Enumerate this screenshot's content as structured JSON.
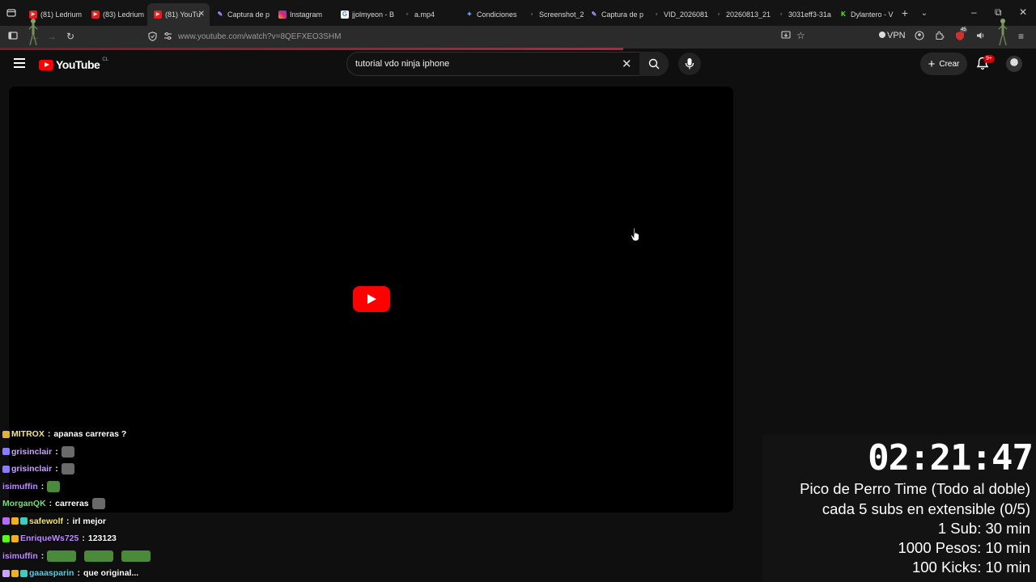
{
  "browser": {
    "tabs": [
      {
        "label": "(81) Ledrium",
        "favicon": "youtube-icon",
        "active": false
      },
      {
        "label": "(83) Ledrium",
        "favicon": "youtube-icon",
        "active": false
      },
      {
        "label": "(81) YouTu",
        "favicon": "youtube-icon",
        "active": true
      },
      {
        "label": "Captura de p",
        "favicon": "pen-icon",
        "active": false
      },
      {
        "label": "Instagram",
        "favicon": "instagram-icon",
        "active": false
      },
      {
        "label": "jjolmyeon - B",
        "favicon": "google-icon",
        "active": false
      },
      {
        "label": "a.mp4",
        "favicon": "file-icon",
        "active": false
      },
      {
        "label": "Condiciones",
        "favicon": "gemini-icon",
        "active": false
      },
      {
        "label": "Screenshot_2",
        "favicon": "file-icon",
        "active": false
      },
      {
        "label": "Captura de p",
        "favicon": "pen-icon",
        "active": false
      },
      {
        "label": "VID_2026081",
        "favicon": "file-icon",
        "active": false
      },
      {
        "label": "20260813_21",
        "favicon": "file-icon",
        "active": false
      },
      {
        "label": "3031eff3-31a",
        "favicon": "file-icon",
        "active": false
      },
      {
        "label": "Dylantero - V",
        "favicon": "kick-icon",
        "active": false
      }
    ],
    "url": "www.youtube.com/watch?v=8QEFXEO3SHM",
    "vpn_label": "VPN",
    "extension_badge": "45"
  },
  "youtube": {
    "logo_text": "YouTube",
    "country_code": "CL",
    "search_value": "tutorial vdo ninja iphone",
    "create_label": "Crear",
    "notification_count": "9+"
  },
  "chat": [
    {
      "user": "MITROX",
      "user_color": "#f2e68a",
      "message": "apanas carreras ?",
      "badges": [
        "#e0b23a"
      ],
      "emote": false
    },
    {
      "user": "grisinclair",
      "user_color": "#c9a3ff",
      "message": "",
      "badges": [
        "#8a7dff"
      ],
      "emote": true
    },
    {
      "user": "grisinclair",
      "user_color": "#c9a3ff",
      "message": "",
      "badges": [
        "#8a7dff"
      ],
      "emote": true
    },
    {
      "user": "isimuffin",
      "user_color": "#c08bff",
      "message": "",
      "badges": [],
      "emote": true
    },
    {
      "user": "MorganQK",
      "user_color": "#6ee07a",
      "message": "carreras",
      "badges": [],
      "emote": true
    },
    {
      "user": "safewolf",
      "user_color": "#f5e36a",
      "message": "irl mejor",
      "badges": [
        "#b86bff",
        "#f0b020",
        "#3ad0c0"
      ],
      "emote": false
    },
    {
      "user": "EnriqueWs725",
      "user_color": "#c08bff",
      "message": "123123",
      "badges": [
        "#53fc18",
        "#f0b020"
      ],
      "emote": false
    },
    {
      "user": "isimuffin",
      "user_color": "#c08bff",
      "message": "",
      "badges": [],
      "emote": true
    },
    {
      "user": "gaaasparin",
      "user_color": "#4fd3f0",
      "message": "que original...",
      "badges": [
        "#c9a3ff",
        "#f0b020",
        "#3ad0c0"
      ],
      "emote": false
    }
  ],
  "overlay": {
    "timer": "02:21:47",
    "lines": [
      "Pico de Perro Time (Todo al doble)",
      "cada 5 subs en extensible (0/5)",
      "1 Sub: 30 min",
      "1000 Pesos: 10 min",
      "100 Kicks: 10 min"
    ]
  }
}
